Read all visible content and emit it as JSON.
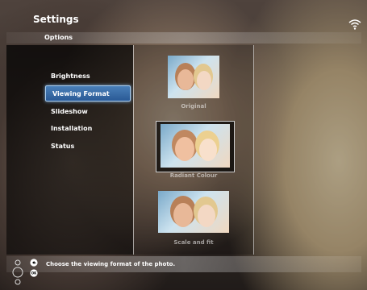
{
  "header": {
    "title": "Settings",
    "subtitle": "Options",
    "wifi_icon": "wifi-icon"
  },
  "menu": {
    "items": [
      {
        "label": "Brightness"
      },
      {
        "label": "Viewing Format",
        "selected": true
      },
      {
        "label": "Slideshow"
      },
      {
        "label": "Installation"
      },
      {
        "label": "Status"
      }
    ]
  },
  "options": {
    "items": [
      {
        "label": "Original"
      },
      {
        "label": "Radiant Colour",
        "highlighted": true
      },
      {
        "label": "Scale and fit"
      }
    ]
  },
  "footer": {
    "hint": "Choose the viewing format of the photo.",
    "icons": [
      "nav-pad-icon",
      "back-icon",
      "ok-icon"
    ]
  },
  "colors": {
    "selection": "#2a5a96",
    "selection_glow": "#a8cdf0"
  }
}
